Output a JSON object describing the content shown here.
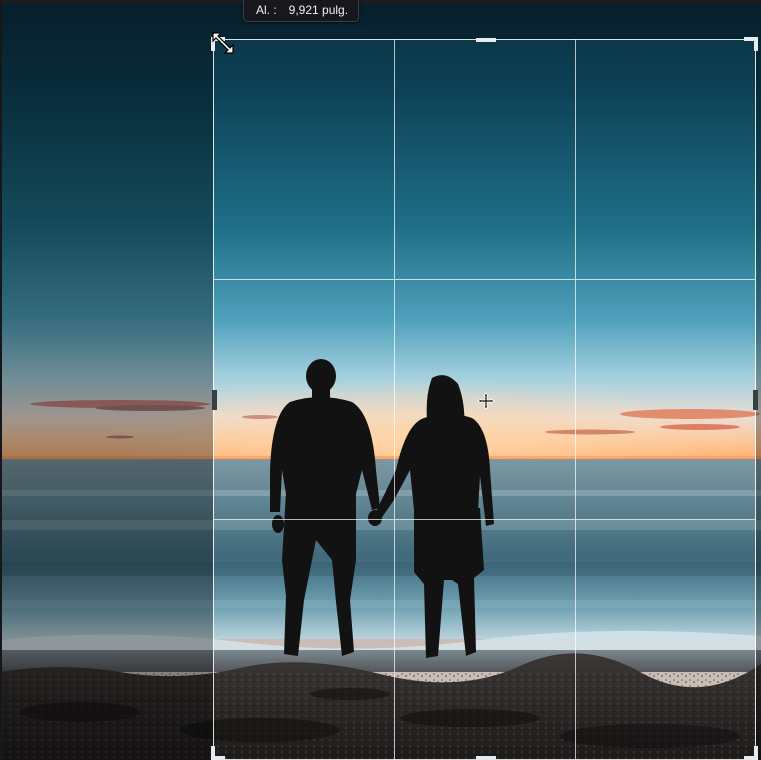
{
  "dimension_tooltip": {
    "label": "Al. :",
    "value": "9,921 pulg."
  },
  "crop": {
    "grid": "rule-of-thirds",
    "outside_dim": true
  },
  "photo": {
    "subject": "couple holding hands on beach at sunset",
    "colors": {
      "sky_top": "#0c3b50",
      "sky_mid": "#2c8aa5",
      "horizon_glow": "#ffc78f",
      "sea": "#5f8a98",
      "sand": "#3a3532"
    }
  },
  "cursors": {
    "resize": "diagonal-resize-icon",
    "move": "move-cursor-icon"
  }
}
